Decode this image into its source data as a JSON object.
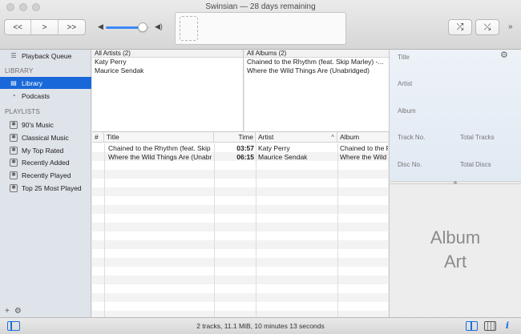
{
  "window": {
    "title": "Swinsian — 28 days remaining"
  },
  "toolbar": {
    "prev_icon": "rewind-icon",
    "play_icon": "play-icon",
    "next_icon": "fast-forward-icon",
    "prev_glyph": "<<",
    "play_glyph": ">",
    "next_glyph": ">>",
    "volume_fraction": 0.85,
    "shuffle_glyph": "⤮",
    "repeat_glyph": "⤯",
    "overflow_glyph": "»"
  },
  "sidebar": {
    "playback_queue": "Playback Queue",
    "library_header": "LIBRARY",
    "library_items": [
      {
        "label": "Library",
        "icon": "library-icon",
        "selected": true
      },
      {
        "label": "Podcasts",
        "icon": "podcast-icon",
        "selected": false
      }
    ],
    "playlists_header": "PLAYLISTS",
    "playlists": [
      {
        "label": "90's Music"
      },
      {
        "label": "Classical Music"
      },
      {
        "label": "My Top Rated"
      },
      {
        "label": "Recently Added"
      },
      {
        "label": "Recently Played"
      },
      {
        "label": "Top 25 Most Played"
      }
    ],
    "add_glyph": "+",
    "gear_glyph": "⚙"
  },
  "artists_browser": {
    "header": "All Artists (2)",
    "rows": [
      "Katy Perry",
      "Maurice Sendak"
    ]
  },
  "albums_browser": {
    "header": "All Albums (2)",
    "rows": [
      "Chained to the Rhythm (feat. Skip Marley) -...",
      "Where the Wild Things Are (Unabridged)"
    ]
  },
  "table": {
    "columns": {
      "num": "#",
      "title": "Title",
      "time": "Time",
      "artist": "Artist",
      "album": "Album"
    },
    "sort_glyph": "^",
    "rows": [
      {
        "title": "Chained to the Rhythm (feat. Skip Marley)",
        "time": "03:57",
        "artist": "Katy Perry",
        "album": "Chained to the Rhythm"
      },
      {
        "title": "Where the Wild Things Are (Unabridged)",
        "time": "06:15",
        "artist": "Maurice Sendak",
        "album": "Where the Wild Things Are"
      }
    ]
  },
  "info": {
    "title": "Title",
    "artist": "Artist",
    "album": "Album",
    "track_no": "Track No.",
    "total_tracks": "Total Tracks",
    "disc_no": "Disc No.",
    "total_discs": "Total Discs",
    "gear_glyph": "⚙"
  },
  "album_art": {
    "line1": "Album",
    "line2": "Art"
  },
  "status": {
    "summary": "2 tracks,  11.1 MiB,  10 minutes 13 seconds",
    "info_glyph": "i"
  }
}
